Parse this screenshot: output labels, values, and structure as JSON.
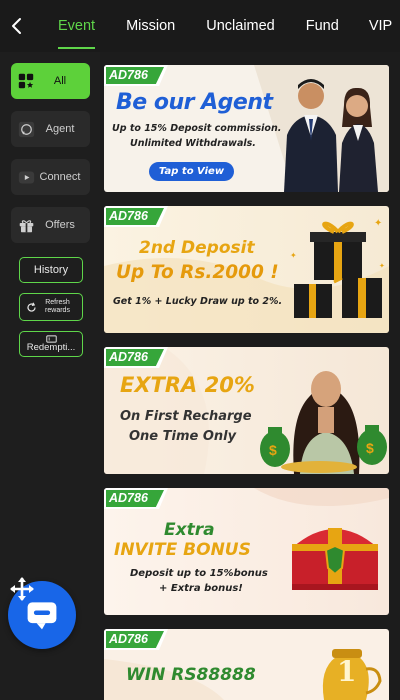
{
  "header": {
    "tabs": [
      {
        "label": "Event",
        "active": true
      },
      {
        "label": "Mission",
        "active": false
      },
      {
        "label": "Unclaimed",
        "active": false
      },
      {
        "label": "Fund",
        "active": false
      },
      {
        "label": "VIP",
        "active": false
      }
    ]
  },
  "sidebar": {
    "categories": [
      {
        "label": "All",
        "icon": "grid-icon",
        "active": true
      },
      {
        "label": "Agent",
        "icon": "whatsapp-icon",
        "active": false
      },
      {
        "label": "Connect",
        "icon": "youtube-icon",
        "active": false
      },
      {
        "label": "Offers",
        "icon": "gift-icon",
        "active": false
      }
    ],
    "buttons": {
      "history": "History",
      "refresh": "Refresh rewards",
      "redemption": "Redempti..."
    }
  },
  "banners": [
    {
      "tag": "AD786",
      "title": "Be our Agent",
      "line1": "Up to 15% Deposit commission.",
      "line2": "Unlimited Withdrawals.",
      "cta": "Tap to View"
    },
    {
      "tag": "AD786",
      "title1": "2nd Deposit",
      "title2": "Up To Rs.2000 !",
      "line1": "Get 1% + Lucky Draw up to 2%."
    },
    {
      "tag": "AD786",
      "title1": "EXTRA 20%",
      "line1": "On First Recharge",
      "line2": "One Time Only"
    },
    {
      "tag": "AD786",
      "title1": "Extra",
      "title2": "INVITE BONUS",
      "line1": "Deposit up to 15%bonus",
      "line2": "+ Extra bonus!"
    },
    {
      "tag": "AD786",
      "title1": "WIN RS88888"
    }
  ],
  "colors": {
    "accent": "#5fd64a",
    "tag_green": "#36a63a",
    "agent_blue": "#1f5fd6",
    "gold": "#e7a512",
    "deep_green": "#2f8a2f",
    "chat_blue": "#1866e8"
  }
}
